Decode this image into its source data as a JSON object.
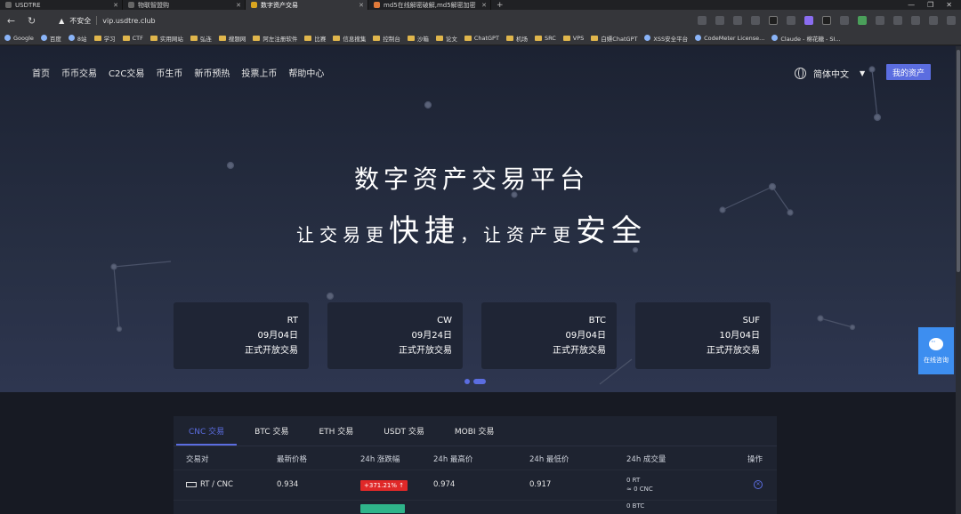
{
  "browser": {
    "tabs": [
      {
        "title": "USDTRE",
        "active": false
      },
      {
        "title": "物联智盟购",
        "active": false
      },
      {
        "title": "数字资产交易",
        "active": true
      },
      {
        "title": "md5在线解密破解,md5解密加密",
        "active": false
      }
    ],
    "security_label": "不安全",
    "url": "vip.usdtre.club",
    "bookmarks": [
      "Google",
      "百度",
      "8站",
      "学习",
      "CTF",
      "实用网站",
      "弘连",
      "搜题网",
      "阿左注册软件",
      "比赛",
      "信息搜集",
      "控制台",
      "沙箱",
      "论文",
      "ChatGPT",
      "机场",
      "SRC",
      "VPS",
      "白嫖ChatGPT",
      "XSS安全平台",
      "CodeMeter License...",
      "Claude - 棉花糖 - SI..."
    ]
  },
  "nav": {
    "items": [
      "首页",
      "币币交易",
      "C2C交易",
      "币生币",
      "新币预热",
      "投票上币",
      "帮助中心"
    ],
    "language": "简体中文",
    "my_assets": "我的资产"
  },
  "hero": {
    "headline": "数字资产交易平台",
    "tagline_part1": "让交易更",
    "tagline_bold1": "快捷",
    "tagline_comma": "，",
    "tagline_part2": "让资产更",
    "tagline_bold2": "安全"
  },
  "launches": [
    {
      "coin": "RT",
      "date": "09月04日",
      "status": "正式开放交易"
    },
    {
      "coin": "CW",
      "date": "09月24日",
      "status": "正式开放交易"
    },
    {
      "coin": "BTC",
      "date": "09月04日",
      "status": "正式开放交易"
    },
    {
      "coin": "SUF",
      "date": "10月04日",
      "status": "正式开放交易"
    }
  ],
  "market": {
    "tabs": [
      "CNC 交易",
      "BTC 交易",
      "ETH 交易",
      "USDT 交易",
      "MOBI 交易"
    ],
    "columns": [
      "交易对",
      "最新价格",
      "24h 涨跌幅",
      "24h 最高价",
      "24h 最低价",
      "24h 成交量",
      "操作"
    ],
    "rows": [
      {
        "pair": "RT / CNC",
        "price": "0.934",
        "change": "+371.21% ↑",
        "high": "0.974",
        "low": "0.917",
        "volume": "0 RT",
        "volume_cnc": "≈ 0 CNC"
      }
    ],
    "partial_row_volume": "0 BTC"
  },
  "consult": {
    "label": "在线咨询"
  },
  "colors": {
    "accent": "#5b6de0",
    "up": "#e02828",
    "down": "#2fb48a",
    "consult": "#3d8ef0"
  }
}
